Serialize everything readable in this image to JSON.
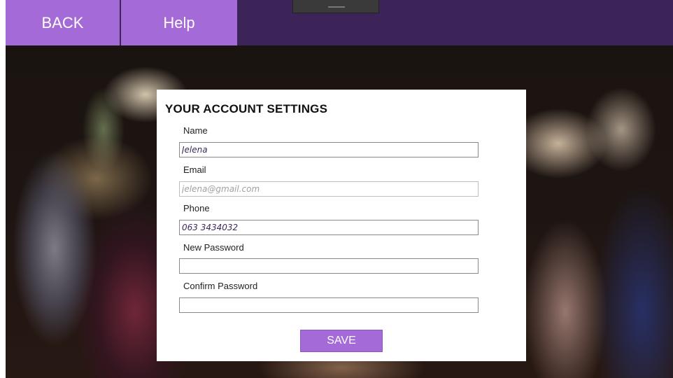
{
  "nav": {
    "back_label": "BACK",
    "help_label": "Help"
  },
  "panel": {
    "title": "YOUR ACCOUNT SETTINGS",
    "fields": {
      "name": {
        "label": "Name",
        "value": "Jelena",
        "placeholder": ""
      },
      "email": {
        "label": "Email",
        "value": "",
        "placeholder": "jelena@gmail.com"
      },
      "phone": {
        "label": "Phone",
        "value": "063 3434032",
        "placeholder": ""
      },
      "new_password": {
        "label": "New Password",
        "value": "",
        "placeholder": ""
      },
      "confirm_password": {
        "label": "Confirm Password",
        "value": "",
        "placeholder": ""
      }
    },
    "save_label": "SAVE"
  },
  "colors": {
    "accent": "#a46ad8",
    "topbar": "#3d2458",
    "input_text": "#3d2a5a"
  }
}
